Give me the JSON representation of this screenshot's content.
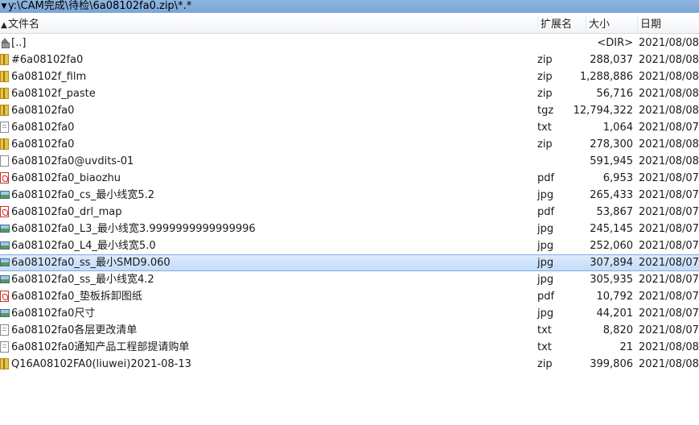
{
  "path_bar": {
    "path": "y:\\CAM完成\\待检\\6a08102fa0.zip\\*.*"
  },
  "header": {
    "name": "文件名",
    "ext": "扩展名",
    "size": "大小",
    "date": "日期"
  },
  "rows": [
    {
      "name": "[..]",
      "ext": "",
      "size": "<DIR>",
      "date": "2021/08/08",
      "icon": "parent-dir-icon",
      "kind": "up"
    },
    {
      "name": "#6a08102fa0",
      "ext": "zip",
      "size": "288,037",
      "date": "2021/08/08",
      "icon": "zip-archive-icon",
      "kind": "zip"
    },
    {
      "name": "6a08102f_film",
      "ext": "zip",
      "size": "1,288,886",
      "date": "2021/08/08",
      "icon": "zip-archive-icon",
      "kind": "zip"
    },
    {
      "name": "6a08102f_paste",
      "ext": "zip",
      "size": "56,716",
      "date": "2021/08/08",
      "icon": "zip-archive-icon",
      "kind": "zip"
    },
    {
      "name": "6a08102fa0",
      "ext": "tgz",
      "size": "12,794,322",
      "date": "2021/08/08",
      "icon": "zip-archive-icon",
      "kind": "zip"
    },
    {
      "name": "6a08102fa0",
      "ext": "txt",
      "size": "1,064",
      "date": "2021/08/07",
      "icon": "text-file-icon",
      "kind": "txt"
    },
    {
      "name": "6a08102fa0",
      "ext": "zip",
      "size": "278,300",
      "date": "2021/08/08",
      "icon": "zip-archive-icon",
      "kind": "zip"
    },
    {
      "name": "6a08102fa0@uvdits-01",
      "ext": "",
      "size": "591,945",
      "date": "2021/08/08",
      "icon": "blank-file-icon",
      "kind": "blank"
    },
    {
      "name": "6a08102fa0_biaozhu",
      "ext": "pdf",
      "size": "6,953",
      "date": "2021/08/07",
      "icon": "pdf-file-icon",
      "kind": "pdf"
    },
    {
      "name": "6a08102fa0_cs_最小线宽5.2",
      "ext": "jpg",
      "size": "265,433",
      "date": "2021/08/07",
      "icon": "image-file-icon",
      "kind": "jpg"
    },
    {
      "name": "6a08102fa0_drl_map",
      "ext": "pdf",
      "size": "53,867",
      "date": "2021/08/07",
      "icon": "pdf-file-icon",
      "kind": "pdf"
    },
    {
      "name": "6a08102fa0_L3_最小线宽3.9999999999999996",
      "ext": "jpg",
      "size": "245,145",
      "date": "2021/08/07",
      "icon": "image-file-icon",
      "kind": "jpg"
    },
    {
      "name": "6a08102fa0_L4_最小线宽5.0",
      "ext": "jpg",
      "size": "252,060",
      "date": "2021/08/07",
      "icon": "image-file-icon",
      "kind": "jpg"
    },
    {
      "name": "6a08102fa0_ss_最小SMD9.060",
      "ext": "jpg",
      "size": "307,894",
      "date": "2021/08/07",
      "icon": "image-file-icon",
      "kind": "jpg",
      "selected": true
    },
    {
      "name": "6a08102fa0_ss_最小线宽4.2",
      "ext": "jpg",
      "size": "305,935",
      "date": "2021/08/07",
      "icon": "image-file-icon",
      "kind": "jpg"
    },
    {
      "name": "6a08102fa0_垫板拆卸图纸",
      "ext": "pdf",
      "size": "10,792",
      "date": "2021/08/07",
      "icon": "pdf-file-icon",
      "kind": "pdf"
    },
    {
      "name": "6a08102fa0尺寸",
      "ext": "jpg",
      "size": "44,201",
      "date": "2021/08/07",
      "icon": "image-file-icon",
      "kind": "jpg"
    },
    {
      "name": "6a08102fa0各层更改清单",
      "ext": "txt",
      "size": "8,820",
      "date": "2021/08/07",
      "icon": "text-file-icon",
      "kind": "txt"
    },
    {
      "name": "6a08102fa0通知产品工程部提请购单",
      "ext": "txt",
      "size": "21",
      "date": "2021/08/08",
      "icon": "text-file-icon",
      "kind": "txt"
    },
    {
      "name": "Q16A08102FA0(liuwei)2021-08-13",
      "ext": "zip",
      "size": "399,806",
      "date": "2021/08/08",
      "icon": "zip-archive-icon",
      "kind": "zip"
    }
  ]
}
